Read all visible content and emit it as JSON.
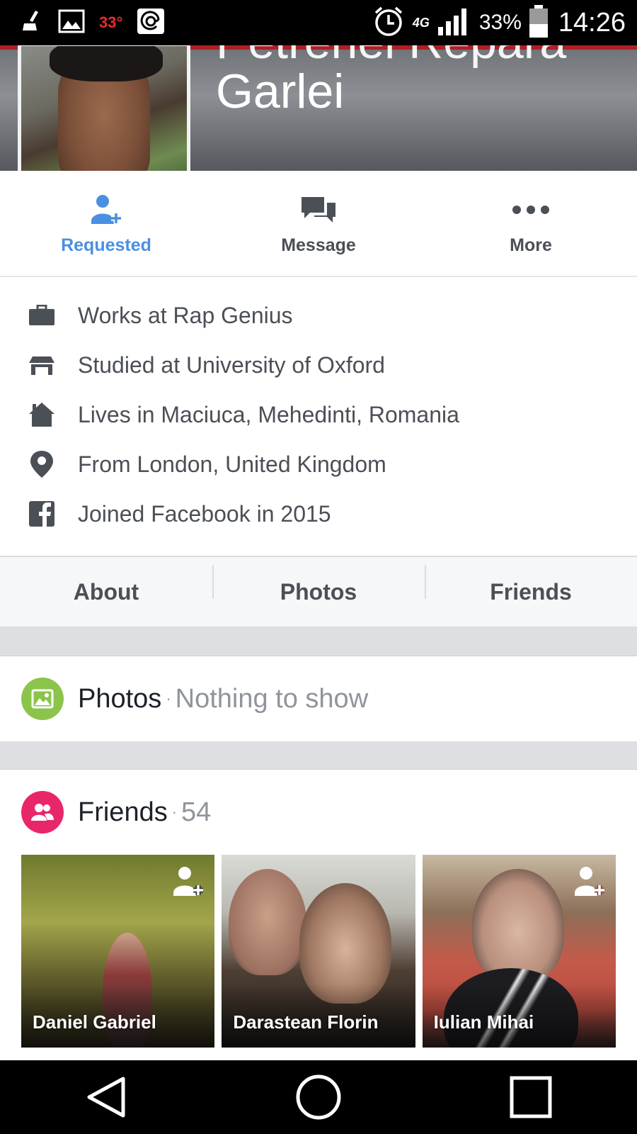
{
  "status_bar": {
    "temperature": "33°",
    "network": "4G",
    "battery_pct": "33%",
    "time": "14:26",
    "icons": [
      "broom-icon",
      "gallery-icon",
      "at-icon",
      "alarm-icon",
      "signal-icon",
      "battery-icon"
    ]
  },
  "profile": {
    "name_top_partial": "Petrenel Repara",
    "name_second_line": "Garlei"
  },
  "actions": [
    {
      "label": "Requested",
      "icon": "friend-requested-icon",
      "active": true
    },
    {
      "label": "Message",
      "icon": "message-icon",
      "active": false
    },
    {
      "label": "More",
      "icon": "more-icon",
      "active": false
    }
  ],
  "intro": [
    {
      "icon": "briefcase-icon",
      "text": "Works at Rap Genius"
    },
    {
      "icon": "graduation-cap-icon",
      "text": "Studied at University of Oxford"
    },
    {
      "icon": "home-icon",
      "text": "Lives in Maciuca, Mehedinti, Romania"
    },
    {
      "icon": "location-pin-icon",
      "text": "From London, United Kingdom"
    },
    {
      "icon": "facebook-icon",
      "text": "Joined Facebook in 2015"
    }
  ],
  "tabs": [
    {
      "label": "About"
    },
    {
      "label": "Photos"
    },
    {
      "label": "Friends"
    }
  ],
  "photos_section": {
    "title": "Photos",
    "separator": "·",
    "subtitle": "Nothing to show",
    "accent": "#8cc44b"
  },
  "friends_section": {
    "title": "Friends",
    "separator": "·",
    "count": "54",
    "accent": "#e8276b"
  },
  "friends": [
    {
      "name": "Daniel Gabriel",
      "show_add": true
    },
    {
      "name": "Darastean Florin",
      "show_add": false
    },
    {
      "name": "Iulian Mihai",
      "show_add": true
    }
  ],
  "colors": {
    "accent_blue": "#4a90e2",
    "text_gray": "#4b4f56",
    "muted": "#90949c"
  },
  "nav": [
    "back-icon",
    "home-circle-icon",
    "recents-icon"
  ]
}
